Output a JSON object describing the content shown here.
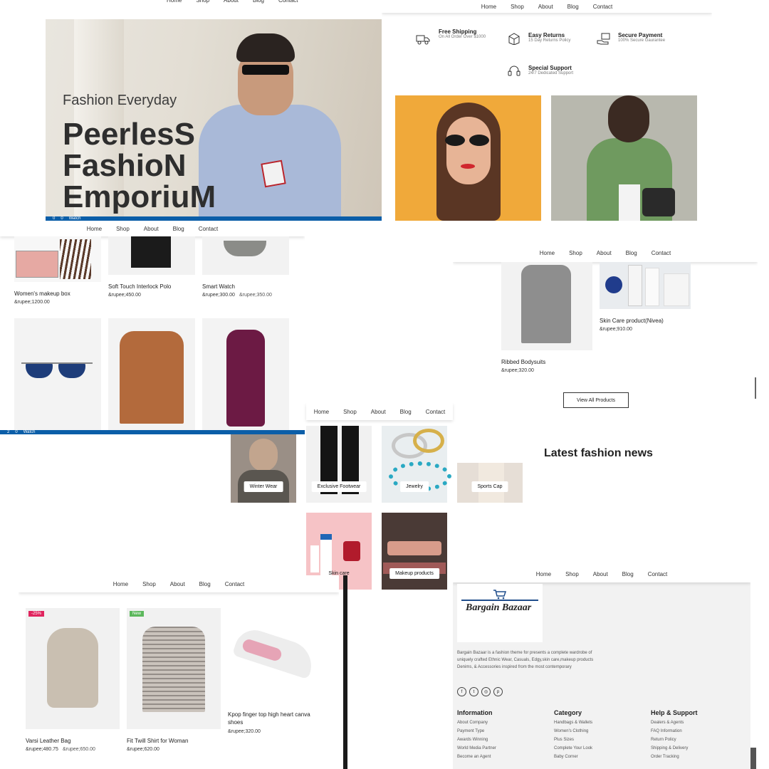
{
  "nav": [
    "Home",
    "Shop",
    "About",
    "Blog",
    "Contact"
  ],
  "hero": {
    "tagline": "Fashion Everyday",
    "title_lines": [
      "PeerlesS",
      "FashioN",
      "EmporiuM"
    ],
    "status": [
      "0",
      "0",
      "Watch"
    ]
  },
  "features": [
    {
      "title": "Free Shipping",
      "sub": "On All Order Over $1000",
      "icon": "truck-icon"
    },
    {
      "title": "Easy Returns",
      "sub": "15 Day Returns Policy",
      "icon": "return-box-icon"
    },
    {
      "title": "Secure Payment",
      "sub": "100% Secure Gaurantee",
      "icon": "hand-payment-icon"
    },
    {
      "title": "Special Support",
      "sub": "24/7 Dedicated Support",
      "icon": "headset-icon"
    }
  ],
  "products_top": [
    {
      "name": "Women's makeup box",
      "price": "&rupee;1200.00"
    },
    {
      "name": "Soft Touch Interlock Polo",
      "price": "&rupee;450.00"
    },
    {
      "name": "Smart Watch",
      "price": "&rupee;300.00",
      "old": "&rupee;350.00"
    }
  ],
  "status_bottom": [
    "2",
    "0",
    "Watch"
  ],
  "products_right": [
    {
      "name": "Ribbed Bodysuits",
      "price": "&rupee;320.00"
    },
    {
      "name": "Skin Care product(Nivea)",
      "price": "&rupee;910.00"
    }
  ],
  "view_all": "View All Products",
  "latest_news": "Latest fashion news",
  "categories": [
    "Winter Wear",
    "Exclusive Footwear",
    "Jewelry",
    "Sports Cap",
    "Skin care",
    "Makeup products"
  ],
  "products_bottom": [
    {
      "name": "Varsi Leather Bag",
      "price": "&rupee;480.75",
      "old": "&rupee;650.00",
      "badge": "-25%"
    },
    {
      "name": "Fit Twill Shirt for Woman",
      "price": "&rupee;620.00",
      "badge": "New"
    },
    {
      "name": "Kpop finger top high heart canva shoes",
      "price": "&rupee;320.00"
    }
  ],
  "footer": {
    "logo": "Bargain Bazaar",
    "desc": "Bargain Bazaar is a fashion theme for presents a complete wardrobe of uniquely crafted Ethnic Wear, Casuals, Edgy,skin care,makeup products Denims, & Accessories inspired from the most contemporary",
    "cols": [
      {
        "title": "Information",
        "links": [
          "About Company",
          "Payment Type",
          "Awards Winning",
          "World Media Partner",
          "Become an Agent"
        ]
      },
      {
        "title": "Category",
        "links": [
          "Handbags & Wallets",
          "Women's Clothing",
          "Plus Sizes",
          "Complete Your Look",
          "Baby Corner"
        ]
      },
      {
        "title": "Help & Support",
        "links": [
          "Dealers & Agents",
          "FAQ Information",
          "Return Policy",
          "Shipping & Delivery",
          "Order Tracking"
        ]
      }
    ]
  },
  "colors": {
    "accent": "#0b5ea8",
    "badge_sale": "#e0245e",
    "badge_new": "#5cb85c"
  }
}
